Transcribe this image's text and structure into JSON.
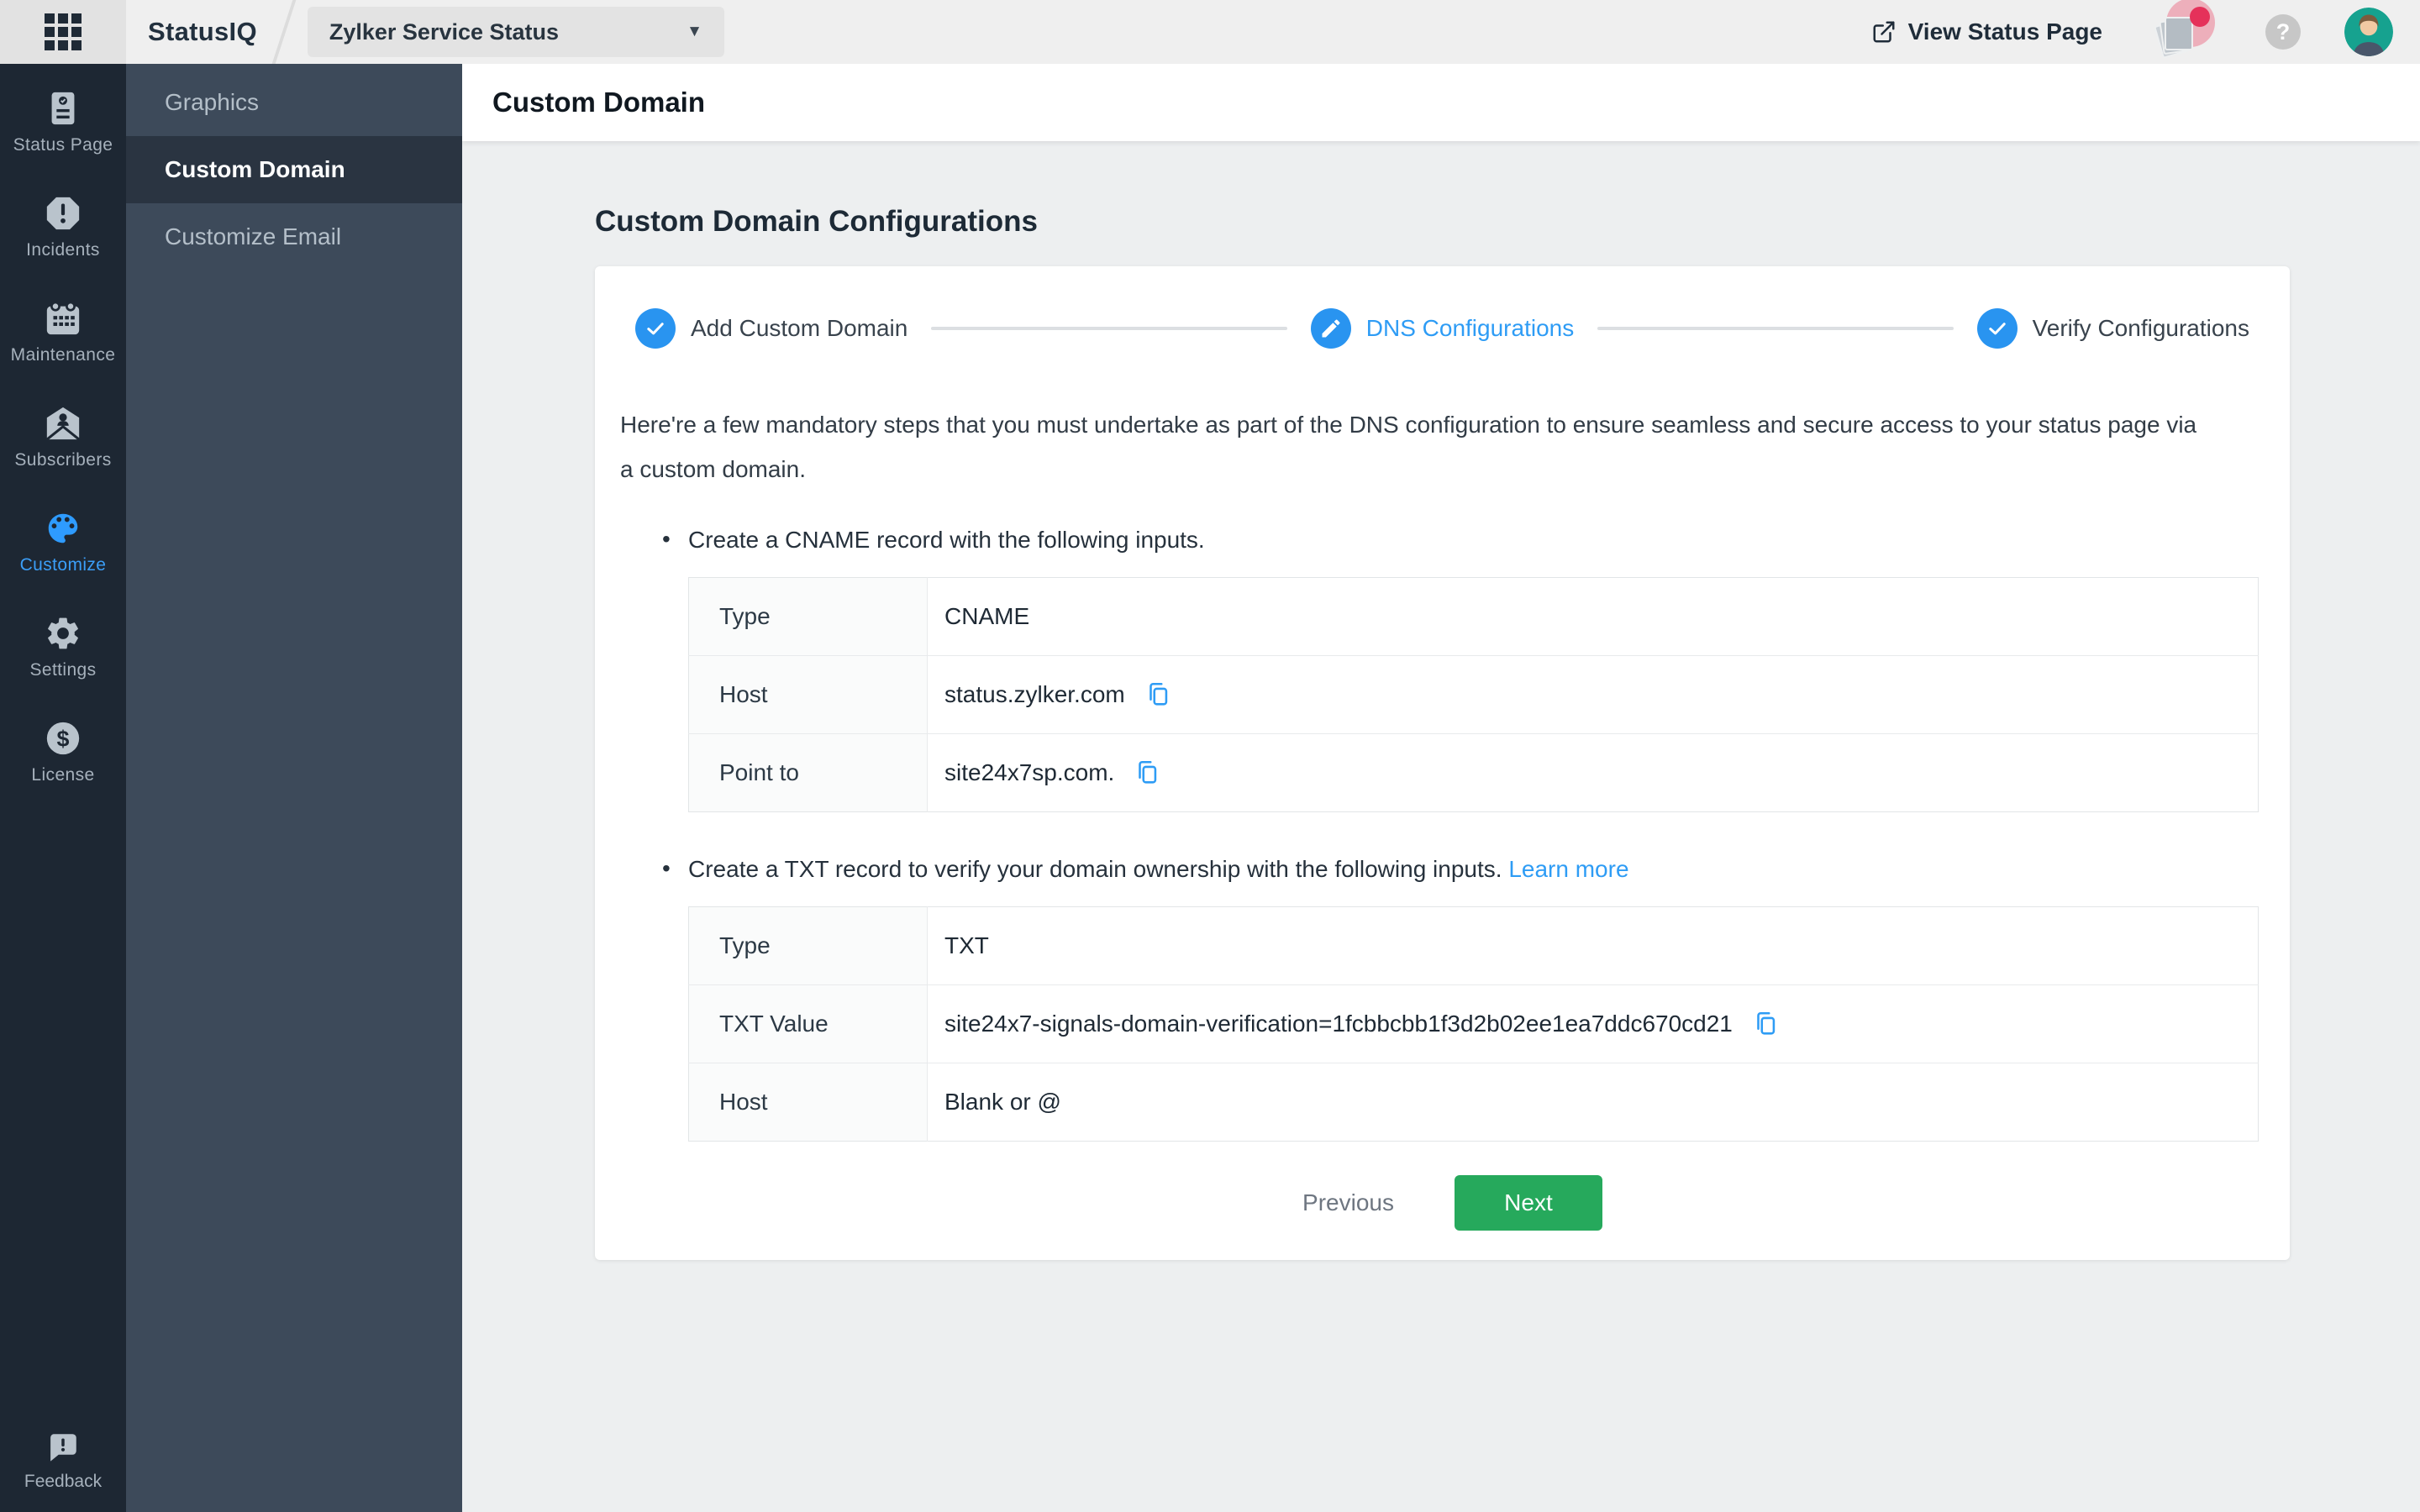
{
  "topbar": {
    "app_name": "StatusIQ",
    "status_selector_value": "Zylker Service Status",
    "view_status_page_label": "View Status Page"
  },
  "icons": {
    "caret_glyph": "▼",
    "question_glyph": "?",
    "bullet_glyph": "•",
    "dollar_glyph": "$"
  },
  "sidebar": {
    "items": [
      {
        "label": "Status Page",
        "icon": "status-page-icon",
        "active": false
      },
      {
        "label": "Incidents",
        "icon": "incidents-icon",
        "active": false
      },
      {
        "label": "Maintenance",
        "icon": "maintenance-icon",
        "active": false
      },
      {
        "label": "Subscribers",
        "icon": "subscribers-icon",
        "active": false
      },
      {
        "label": "Customize",
        "icon": "customize-palette-icon",
        "active": true
      },
      {
        "label": "Settings",
        "icon": "settings-gear-icon",
        "active": false
      },
      {
        "label": "License",
        "icon": "license-dollar-icon",
        "active": false
      }
    ],
    "feedback_label": "Feedback"
  },
  "submenu": {
    "items": [
      {
        "label": "Graphics",
        "active": false
      },
      {
        "label": "Custom Domain",
        "active": true
      },
      {
        "label": "Customize Email",
        "active": false
      }
    ]
  },
  "header": {
    "title": "Custom Domain"
  },
  "main": {
    "page_title": "Custom Domain Configurations",
    "stepper": [
      {
        "label": "Add Custom Domain",
        "icon": "check-icon",
        "state": "done"
      },
      {
        "label": "DNS Configurations",
        "icon": "pencil-icon",
        "state": "current"
      },
      {
        "label": "Verify Configurations",
        "icon": "check-icon",
        "state": "done"
      }
    ],
    "intro": "Here're a few mandatory steps that you must undertake as part of the DNS configuration to ensure seamless and secure access to your status page via a custom domain.",
    "bullet_cname": "Create a CNAME record with the following inputs.",
    "bullet_txt": "Create a TXT record to verify your domain ownership with the following inputs.",
    "learn_more_label": "Learn more",
    "cname_table": {
      "rows": [
        {
          "label": "Type",
          "value": "CNAME"
        },
        {
          "label": "Host",
          "value": "status.zylker.com"
        },
        {
          "label": "Point to",
          "value": "site24x7sp.com."
        }
      ]
    },
    "txt_table": {
      "rows": [
        {
          "label": "Type",
          "value": "TXT"
        },
        {
          "label": "TXT Value",
          "value": "site24x7-signals-domain-verification=1fcbbcbb1f3d2b02ee1ea7ddc670cd21"
        },
        {
          "label": "Host",
          "value": "Blank or @"
        }
      ]
    },
    "buttons": {
      "previous": "Previous",
      "next": "Next"
    }
  },
  "colors": {
    "accent_blue": "#2994f0",
    "link_blue": "#2e9cf5",
    "next_green": "#26a95c",
    "rail_bg": "#1d2733",
    "submenu_bg": "#3d4a5a",
    "submenu_active_bg": "#2a3441",
    "content_bg": "#edeff0",
    "notification_red": "#e5315a",
    "avatar_teal": "#16a28f"
  }
}
